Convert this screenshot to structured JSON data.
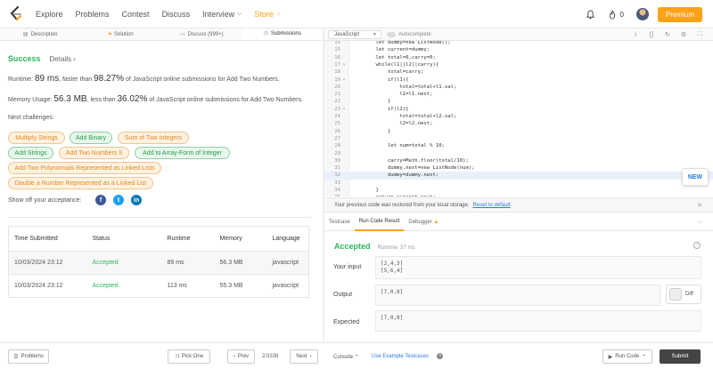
{
  "nav": {
    "items": [
      {
        "label": "Explore"
      },
      {
        "label": "Problems"
      },
      {
        "label": "Contest"
      },
      {
        "label": "Discuss"
      },
      {
        "label": "Interview"
      },
      {
        "label": "Store"
      }
    ],
    "notification_count": "0",
    "premium_label": "Premium"
  },
  "left_tabs": [
    {
      "label": "Description"
    },
    {
      "label": "Solution"
    },
    {
      "label": "Discuss (999+)"
    },
    {
      "label": "Submissions"
    }
  ],
  "result": {
    "status": "Success",
    "details_link": "Details ›",
    "runtime_prefix": "Runtime: ",
    "runtime_value": "89 ms",
    "runtime_mid": ", faster than ",
    "runtime_pct": "98.27%",
    "runtime_suffix": " of JavaScript online submissions for Add Two Numbers.",
    "memory_prefix": "Memory Usage: ",
    "memory_value": "56.3 MB",
    "memory_mid": ", less than ",
    "memory_pct": "36.02%",
    "memory_suffix": " of JavaScript online submissions for Add Two Numbers.",
    "next_challenges_label": "Next challenges:",
    "share_label": "Show off your acceptance:"
  },
  "challenges": [
    {
      "label": "Multiply Strings",
      "difficulty": "medium"
    },
    {
      "label": "Add Binary",
      "difficulty": "easy"
    },
    {
      "label": "Sum of Two Integers",
      "difficulty": "medium"
    },
    {
      "label": "Add Strings",
      "difficulty": "easy"
    },
    {
      "label": "Add Two Numbers II",
      "difficulty": "medium"
    },
    {
      "label": "Add to Array-Form of Integer",
      "difficulty": "easy"
    },
    {
      "label": "Add Two Polynomials Represented as Linked Lists",
      "difficulty": "medium"
    },
    {
      "label": "Double a Number Represented as a Linked List",
      "difficulty": "medium"
    }
  ],
  "social": {
    "facebook": "f",
    "twitter": "t",
    "linkedin": "in"
  },
  "submissions": {
    "headers": [
      "Time Submitted",
      "Status",
      "Runtime",
      "Memory",
      "Language"
    ],
    "rows": [
      [
        "10/03/2024 23:12",
        "Accepted",
        "89 ms",
        "56.3 MB",
        "javascript"
      ],
      [
        "10/03/2024 23:12",
        "Accepted",
        "113 ms",
        "55.3 MB",
        "javascript"
      ]
    ]
  },
  "editor": {
    "language": "JavaScript",
    "autocomplete_label": "Autocomplete",
    "lines": [
      {
        "n": "14",
        "fold": "",
        "text": "    let dummy=new ListNode();"
      },
      {
        "n": "15",
        "fold": "",
        "text": "    let current=dummy;"
      },
      {
        "n": "16",
        "fold": "",
        "text": "    let total=0,carry=0;"
      },
      {
        "n": "17",
        "fold": "▾",
        "text": "    while(l1||l2||carry){"
      },
      {
        "n": "18",
        "fold": "",
        "text": "        total=carry;"
      },
      {
        "n": "19",
        "fold": "▾",
        "text": "        if(l1){"
      },
      {
        "n": "20",
        "fold": "",
        "text": "            total=total+l1.val;"
      },
      {
        "n": "21",
        "fold": "",
        "text": "            l1=l1.next;"
      },
      {
        "n": "22",
        "fold": "",
        "text": "        }"
      },
      {
        "n": "23",
        "fold": "▾",
        "text": "        if(l2){"
      },
      {
        "n": "24",
        "fold": "",
        "text": "            total=total+l2.val;"
      },
      {
        "n": "25",
        "fold": "",
        "text": "            l2=l2.next;"
      },
      {
        "n": "26",
        "fold": "",
        "text": "        }"
      },
      {
        "n": "27",
        "fold": "",
        "text": ""
      },
      {
        "n": "28",
        "fold": "",
        "text": "        let num=total % 10;"
      },
      {
        "n": "29",
        "fold": "",
        "text": ""
      },
      {
        "n": "30",
        "fold": "",
        "text": "        carry=Math.floor(total/10);"
      },
      {
        "n": "31",
        "fold": "",
        "text": "        dummy.next=new ListNode(num);"
      },
      {
        "n": "32",
        "fold": "",
        "text": "        dummy=dummy.next;"
      },
      {
        "n": "33",
        "fold": "",
        "text": ""
      },
      {
        "n": "34",
        "fold": "",
        "text": "    }"
      },
      {
        "n": "35",
        "fold": "",
        "text": "    return current.next;"
      }
    ],
    "highlighted_line": "32",
    "new_badge": "NEW"
  },
  "restore": {
    "message": "Your previous code was restored from your local storage.",
    "reset_link": "Reset to default"
  },
  "result_tabs": [
    {
      "label": "Testcase"
    },
    {
      "label": "Run Code Result"
    },
    {
      "label": "Debugger"
    }
  ],
  "run_result": {
    "status": "Accepted",
    "runtime": "Runtime: 57 ms",
    "input_label": "Your input",
    "input_value": "[2,4,3]\n[5,6,4]",
    "output_label": "Output",
    "output_value": "[7,0,8]",
    "diff_label": "Diff",
    "expected_label": "Expected",
    "expected_value": "[7,0,8]"
  },
  "bottom": {
    "problems_label": "Problems",
    "pick_one_label": "Pick One",
    "prev_label": "Prev",
    "page_count": "2/3338",
    "next_label": "Next",
    "console_label": "Console",
    "use_example_label": "Use Example Testcases",
    "run_code_label": "Run Code",
    "submit_label": "Submit"
  },
  "colors": {
    "accent": "#ffa116",
    "success": "#2db55d",
    "link": "#2a7ae2"
  }
}
